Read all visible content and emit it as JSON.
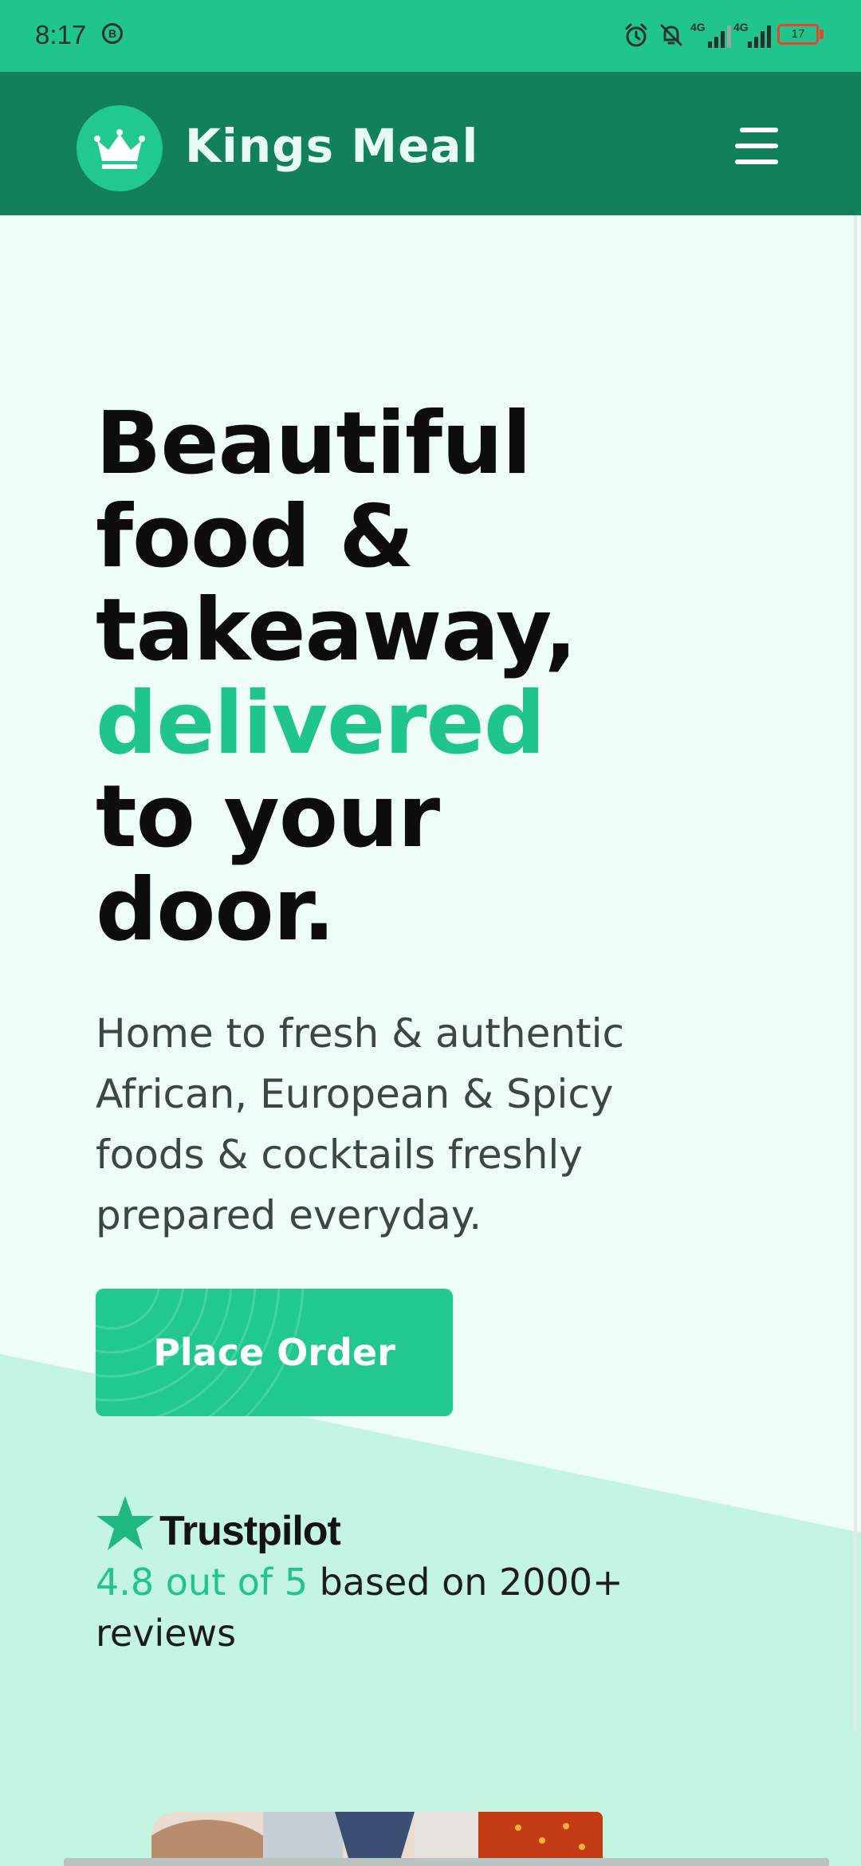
{
  "status_bar": {
    "time": "8:17",
    "notification_badge": "B",
    "icons": [
      "alarm-icon",
      "mute-icon",
      "signal-icon",
      "signal-icon"
    ],
    "network_labels": [
      "4G",
      "4G"
    ],
    "battery_level": "17",
    "battery_color": "#e8442e"
  },
  "header": {
    "brand": "Kings Meal",
    "logo_icon": "crown-icon",
    "menu_icon": "hamburger-menu-icon",
    "background": "#12805a",
    "logo_background": "#22c98f"
  },
  "hero": {
    "title_lines": [
      "Beautiful",
      "food &",
      "takeaway,",
      "delivered",
      "to your",
      "door."
    ],
    "accent_line_index": 3,
    "subtitle": "Home to fresh & authentic African, European & Spicy foods & cocktails freshly prepared everyday.",
    "cta_label": "Place Order",
    "accent_color": "#20c48d"
  },
  "trustpilot": {
    "brand": "Trustpilot",
    "star_icon": "star-icon",
    "rating_text": "4.8 out of 5",
    "rest_text": " based on 2000+ reviews"
  }
}
